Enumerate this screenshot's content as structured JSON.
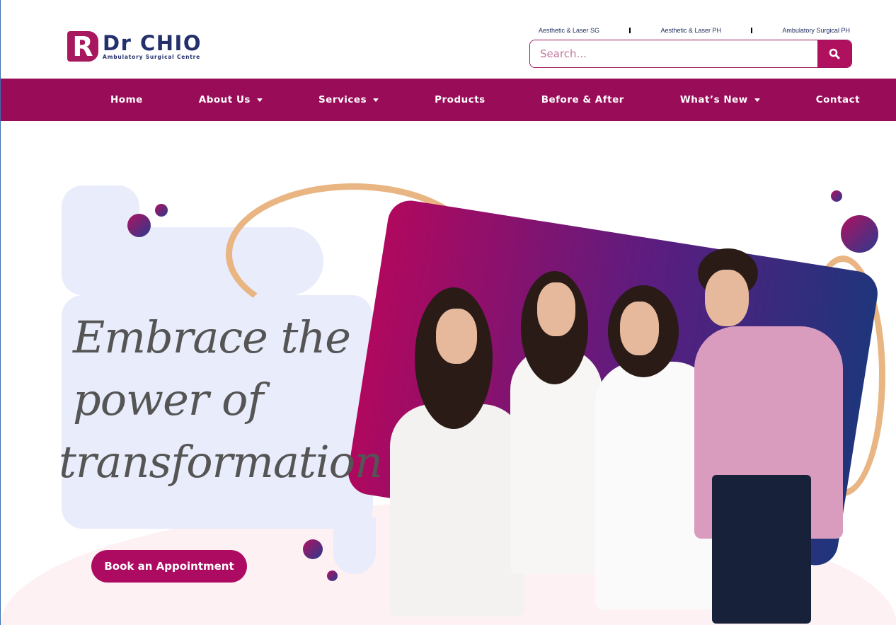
{
  "header": {
    "logo": {
      "mark": "R",
      "title": "Dr CHIO",
      "subtitle": "Ambulatory Surgical Centre"
    },
    "top_links": [
      "Aesthetic & Laser SG",
      "Aesthetic & Laser PH",
      "Ambulatory Surgical PH"
    ],
    "search": {
      "placeholder": "Search...",
      "value": "",
      "button_icon": "search-icon"
    }
  },
  "nav": {
    "items": [
      {
        "label": "Home",
        "dropdown": false
      },
      {
        "label": "About Us",
        "dropdown": true
      },
      {
        "label": "Services",
        "dropdown": true
      },
      {
        "label": "Products",
        "dropdown": false
      },
      {
        "label": "Before & After",
        "dropdown": false
      },
      {
        "label": "What’s New",
        "dropdown": true
      },
      {
        "label": "Contact",
        "dropdown": false
      }
    ],
    "background": "#990d58"
  },
  "hero": {
    "headline_lines": [
      "Embrace the",
      "power of",
      "transformation"
    ],
    "cta_label": "Book an Appointment",
    "accent": "#ad0b62"
  }
}
